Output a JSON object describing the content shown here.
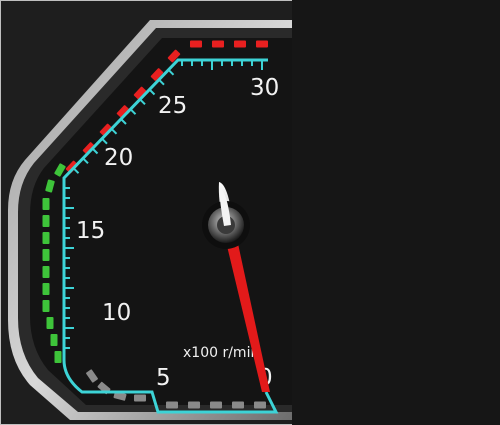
{
  "gauge": {
    "scale_labels": [
      "30",
      "25",
      "20",
      "15",
      "10",
      "5",
      "0"
    ],
    "unit": "x100 r/min",
    "reading": 0,
    "colors": {
      "redline": "#e82020",
      "green": "#3ec43a",
      "idle_gray": "#8a8a8a",
      "scale": "#3dd3d6",
      "needle": "#e21a1a",
      "face": "#141414"
    }
  }
}
